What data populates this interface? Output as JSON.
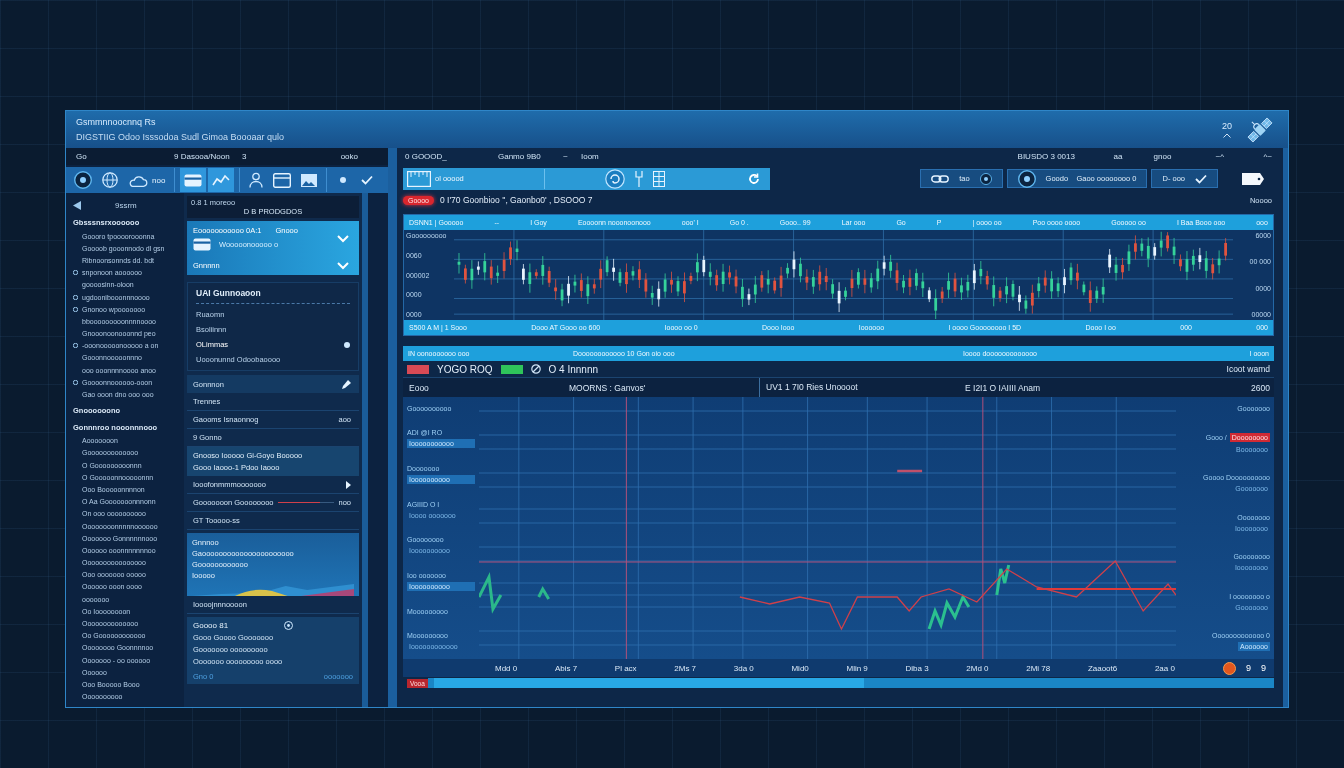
{
  "header": {
    "title": "Gsmmnnoocnnq Rs",
    "subtitle": "DIGSTIIG Odoo Isssodoa  Sudl Gimoa  Boooaar qulo",
    "counter": "20"
  },
  "left_panel": {
    "top_bar": {
      "left": "Go",
      "center": "9 Dasooa/Noon",
      "mark": "3",
      "right": "ooko"
    },
    "toolbar": [
      {
        "selected": false
      },
      {
        "selected": false
      },
      {
        "selected": false,
        "label": "noo"
      },
      {
        "selected": true
      },
      {
        "selected": true
      },
      {
        "selected": false
      },
      {
        "selected": false
      },
      {
        "selected": false
      },
      {
        "selected": false
      },
      {
        "selected": false
      }
    ],
    "sidebar": {
      "title": "9ssrm",
      "items": [
        {
          "kind": "heading",
          "text": "Gbsssnsrxoooooo"
        },
        {
          "kind": "item",
          "text": "Goooro tpoooorooonna"
        },
        {
          "kind": "item",
          "text": "Goooob gooonnodo dl gsn"
        },
        {
          "kind": "item",
          "text": "Ribnoonsonnds dd. bdt"
        },
        {
          "kind": "marked",
          "text": "snponoon aoooooo"
        },
        {
          "kind": "item",
          "text": "goooosinn-oloon"
        },
        {
          "kind": "marked",
          "text": "ugdoonibooonnnoooo"
        },
        {
          "kind": "marked",
          "text": "Gnonoo  wpooooooo"
        },
        {
          "kind": "item",
          "text": "bbooooooooonnnnoooo"
        },
        {
          "kind": "item",
          "text": "Gnooonoonooonnd peo"
        },
        {
          "kind": "marked",
          "text": "-ooonooooonooooo a on"
        },
        {
          "kind": "item",
          "text": "Gooonnooooonnno"
        },
        {
          "kind": "item",
          "text": "ooo ooonnnnoooo anoo"
        },
        {
          "kind": "marked",
          "text": "Goooonnoooooo-ooon"
        },
        {
          "kind": "item",
          "text": "Gao ooon dno ooo ooo"
        },
        {
          "kind": "heading",
          "text": "Gnoooooono"
        },
        {
          "kind": "heading",
          "text": "Gonnnroo nooonnnooo"
        },
        {
          "kind": "item",
          "text": "Aooooooon"
        },
        {
          "kind": "item",
          "text": "Gooooooooooooo"
        },
        {
          "kind": "item",
          "text": "O Gooooooooonnn"
        },
        {
          "kind": "item",
          "text": "O Gooooonnooooonnn"
        },
        {
          "kind": "item",
          "text": "Ooo Booooonnnnon"
        },
        {
          "kind": "item",
          "text": "O Aa Gooooooonnnonn"
        },
        {
          "kind": "item",
          "text": "On ooo oooooooooo"
        },
        {
          "kind": "item",
          "text": "Oooooooonnnnnoooooo"
        },
        {
          "kind": "item",
          "text": "Ooooooo Gonnnnnnooo"
        },
        {
          "kind": "item",
          "text": "Oooooo ooonnnnnnnoo"
        },
        {
          "kind": "item",
          "text": "Oooooooooooooooo"
        },
        {
          "kind": "item",
          "text": "Ooo ooooooo  ooooo"
        },
        {
          "kind": "item",
          "text": "Oooooo ooon oooo"
        },
        {
          "kind": "item",
          "text": "ooooooo"
        },
        {
          "kind": "item",
          "text": "Oo Ioooooooon"
        },
        {
          "kind": "item",
          "text": "Oooooooooooooo"
        },
        {
          "kind": "item",
          "text": "Oo Goooooooooooo"
        },
        {
          "kind": "item",
          "text": "Oooooooo Goonnnnoo"
        },
        {
          "kind": "item",
          "text": "Ooooooo - oo oooooo"
        },
        {
          "kind": "item",
          "text": "Oooooo"
        },
        {
          "kind": "item",
          "text": "Ooo Booooo Booo"
        },
        {
          "kind": "item",
          "text": "Oooooooooo"
        }
      ]
    },
    "catalog": {
      "caption": "0.8 1 moreoo",
      "title": "D B PRODGDOS"
    },
    "selector": [
      {
        "text": "Eooooooooooo 0A:1",
        "value": "Gnooo",
        "detail": "Wooooonooooo o"
      },
      {
        "text": "Gnnnnn"
      }
    ],
    "list_panel": {
      "title": "UAI Gunnoaoon",
      "items": [
        {
          "text": "Ruaomn",
          "selected": false
        },
        {
          "text": "Bsoliinnn",
          "selected": false
        },
        {
          "text": "OLimmas",
          "selected": true
        },
        {
          "text": "Uooonunnd  Odoobaoooo",
          "selected": false
        }
      ]
    },
    "entries": [
      {
        "kind": "header",
        "text": "Gonnnon"
      },
      {
        "kind": "plain",
        "text": "Trennes"
      },
      {
        "kind": "plain",
        "text": "Gaooms  Isnaonnog",
        "value": "aoo"
      },
      {
        "kind": "plain",
        "text": "9 Gonno"
      },
      {
        "kind": "note",
        "lines": [
          "Gnooso Iooooo  Gi-Goyo  Booooo",
          "Gooo Iaooo-1 Pdoo Iaooo"
        ]
      },
      {
        "kind": "link",
        "text": "Iooofonmmmooooooo"
      },
      {
        "kind": "meter",
        "text": "Gooooooon  Goooooooo",
        "value": "noo",
        "level": 0.75
      },
      {
        "kind": "plain",
        "text": "GT  Tooooo-ss"
      },
      {
        "kind": "chart_card",
        "lines": [
          "Gnnnoo",
          "Gaoooooooooooooooooooooo",
          "Goooooooooooo",
          "Iooooo"
        ]
      },
      {
        "kind": "plain",
        "text": "Ioooojnnnoooon"
      },
      {
        "kind": "detail",
        "title": "Goooo 81",
        "lines": [
          "Gooo Goooo  Gooooooo",
          "Gooooooo ooooooooo",
          "Ooooooo ooooooooo  oooo"
        ],
        "footer": "Gno 0",
        "footer_right": "ooooooo"
      }
    ]
  },
  "right_panel": {
    "top_bar": {
      "left": [
        "0 GOOOD_",
        "Ganmo 9B0",
        "~",
        "Ioom"
      ],
      "right": [
        "BIUSDO 3 0013",
        "aa",
        "gnoo",
        "~^"
      ],
      "corner": "^~"
    },
    "quick_bar": {
      "label": "ol ooood"
    },
    "segments": [
      {
        "text": "tao"
      },
      {
        "text": "Goodo    Gaoo oooooooo 0"
      },
      {
        "text": "D- ooo"
      }
    ],
    "alert": {
      "badge": "Goooo",
      "text": "0  I'70 Goonbioo '',  Gaonbo0' ,  DSOOO 7",
      "right": "Noooo"
    },
    "candles": {
      "header": [
        "DSNN1 | Gooooo",
        "--",
        "I Goy",
        "Eoooonn nooonoonooo",
        "ooo' I",
        "Go 0 .",
        "Gooo.. 99",
        "Lar ooo",
        "Go",
        "P",
        "| oooo oo",
        "Poo  oooo oooo",
        "Gooooo oo",
        "I Baa  Booo ooo",
        "ooo"
      ],
      "left_ticks": [
        "Gooooooooo",
        "0060",
        "000002",
        "0000",
        "0000"
      ],
      "right_ticks": [
        "6000",
        "00 000",
        "0000",
        "00000"
      ],
      "footer": [
        "S500 A M  |  1 Sooo",
        "Dooo AT Gooo oo 600",
        "Ioooo oo 0",
        "Dooo Iooo",
        "Ioooooo",
        "I oooo Goooooooo I  5D",
        "Dooo I oo",
        "000",
        "000"
      ]
    },
    "info_bar": [
      "IN oonooooooo ooo",
      "Doooooooooooo  10  Gon oio ooo",
      "Ioooo  dooooooooooooo",
      "I ooon"
    ],
    "legend": [
      {
        "kind": "swatch",
        "color": "#d84a55"
      },
      {
        "kind": "text",
        "text": "YOGO ROQ"
      },
      {
        "kind": "swatch",
        "color": "#2fc45a"
      },
      {
        "kind": "icon"
      },
      {
        "kind": "text",
        "text": "O 4 Innnnn"
      }
    ],
    "legend_right": "Icoot wamd",
    "columns": [
      "Eooo",
      "MOORNS : Ganvos'",
      "UV1 1 7I0 Ries Unoooot",
      "E I2I1 O IAIIII Anam",
      "2600"
    ],
    "left_labels": [
      {
        "label": "Goooooooooo"
      },
      {
        "label": "ADI @I RO",
        "sub": "Iooooooooooo",
        "highlighted": true
      },
      {
        "label": "Dooooooo",
        "sub": "Ioooooooooo",
        "highlighted": true
      },
      {
        "label": "AGIIID O I",
        "sub": "Ioooo ooooooo",
        "highlighted": false
      },
      {
        "label": "Goooooooo",
        "sub": "Ioooooooooo",
        "highlighted": false
      },
      {
        "label": "Ioo ooooooo",
        "sub": "Ioooooooooo",
        "highlighted": true
      },
      {
        "label": "Mooooooooo"
      },
      {
        "label": "Mooooooooo",
        "sub": "Ioooooooooooo",
        "highlighted": false
      }
    ],
    "right_labels": [
      {
        "label": "Gooooooo"
      },
      {
        "label": "Gooo /",
        "badge": "Doooooooo",
        "sub": "Booooooo",
        "highlighted": false
      },
      {
        "label": "Goooo Doooooooooo",
        "sub": "Gooooooo",
        "highlighted": false
      },
      {
        "label": "Oooooooo",
        "sub": "Ioooooooo",
        "highlighted": false
      },
      {
        "label": "Goooooooo",
        "sub": "Ioooooooo",
        "highlighted": false
      },
      {
        "label": "I oooooooo o",
        "sub": "Gooooooo",
        "highlighted": false
      },
      {
        "label": "Ooooooooooooo 0",
        "sub": "Aoooooo",
        "highlighted": true
      }
    ],
    "x_labels": [
      "Mdd 0",
      "Abis 7",
      "Pl acx",
      "2Ms 7",
      "3da 0",
      "Mid0",
      "Mlin 9",
      "Diba 3",
      "2Md 0",
      "2Mi 78",
      "Zaaoot6",
      "2aa 0"
    ],
    "x_tail": [
      "9",
      "9"
    ],
    "scroll_tag": "Vooa"
  }
}
